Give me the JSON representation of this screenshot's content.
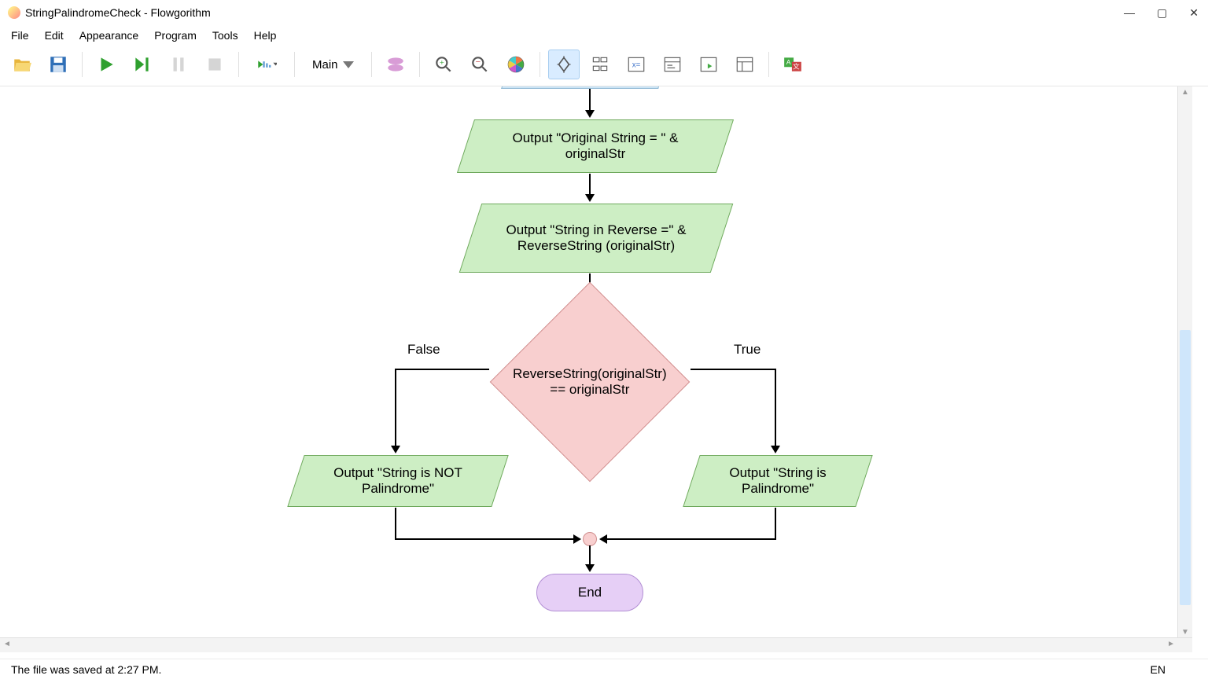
{
  "window": {
    "title": "StringPalindromeCheck - Flowgorithm"
  },
  "menu": [
    "File",
    "Edit",
    "Appearance",
    "Program",
    "Tools",
    "Help"
  ],
  "function_selector": "Main",
  "toolbar_names": [
    "open",
    "save",
    "run",
    "step",
    "pause",
    "stop",
    "speed",
    "function",
    "shape",
    "zoom-in",
    "zoom-out",
    "color",
    "layout-center",
    "layout-indent",
    "variable-watch",
    "console",
    "export-image",
    "export-code",
    "translate"
  ],
  "flowchart": {
    "output1": "Output \"Original String = \" & originalStr",
    "output2": "Output \"String in Reverse =\" & ReverseString (originalStr)",
    "decision": "ReverseString(originalStr) == originalStr",
    "label_false": "False",
    "label_true": "True",
    "out_false": "Output \"String is NOT Palindrome\"",
    "out_true": "Output \"String is Palindrome\"",
    "end": "End"
  },
  "status": {
    "message": "The file was saved at 2:27 PM.",
    "lang": "EN"
  }
}
